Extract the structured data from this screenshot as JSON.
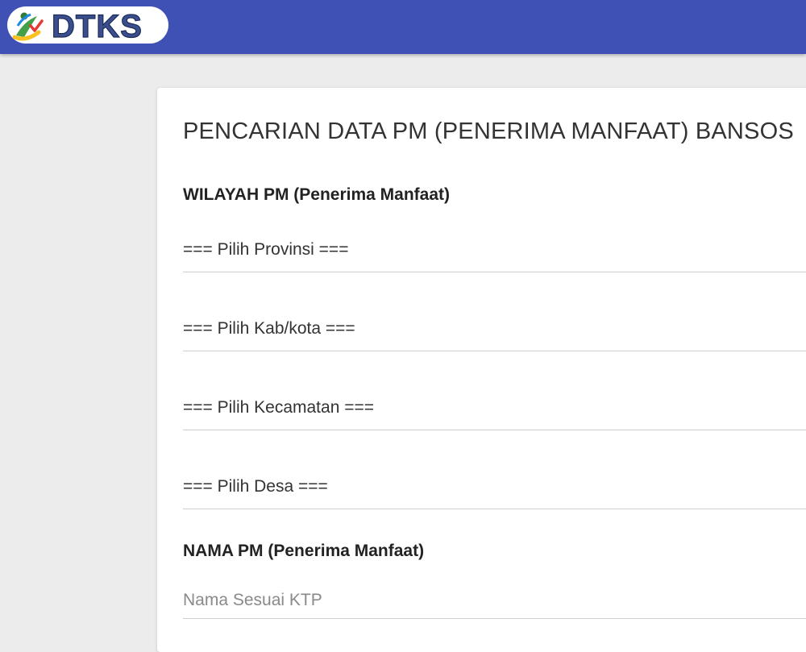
{
  "header": {
    "logo_text": "DTKS",
    "bar_color": "#3f51b5"
  },
  "form": {
    "title": "PENCARIAN DATA PM (PENERIMA MANFAAT) BANSOS",
    "region_label": "WILAYAH PM (Penerima Manfaat)",
    "province_select": "=== Pilih Provinsi ===",
    "city_select": "=== Pilih Kab/kota ===",
    "district_select": "=== Pilih Kecamatan ===",
    "village_select": "=== Pilih Desa ===",
    "name_label": "NAMA PM (Penerima Manfaat)",
    "name_placeholder": "Nama Sesuai KTP"
  }
}
